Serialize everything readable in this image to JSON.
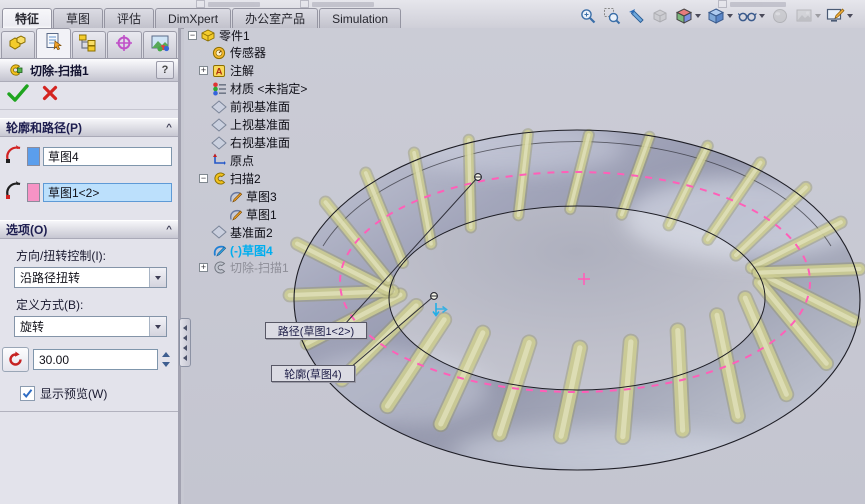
{
  "ribbon": {
    "tabs": [
      {
        "label": "特征",
        "active": true
      },
      {
        "label": "草图",
        "active": false
      },
      {
        "label": "评估",
        "active": false
      },
      {
        "label": "DimXpert",
        "active": false
      },
      {
        "label": "办公室产品",
        "active": false
      },
      {
        "label": "Simulation",
        "active": false
      }
    ]
  },
  "headsup": {
    "icons": [
      {
        "name": "zoom-fit",
        "disabled": false,
        "caret": false
      },
      {
        "name": "zoom-area",
        "disabled": false,
        "caret": false
      },
      {
        "name": "previous-view",
        "disabled": false,
        "caret": false
      },
      {
        "name": "section-view",
        "disabled": true,
        "caret": false
      },
      {
        "name": "view-orientation",
        "disabled": false,
        "caret": true
      },
      {
        "name": "display-style",
        "disabled": false,
        "caret": true
      },
      {
        "name": "hide-show-items",
        "disabled": false,
        "caret": true
      },
      {
        "name": "edit-appearance",
        "disabled": true,
        "caret": false
      },
      {
        "name": "apply-scene",
        "disabled": true,
        "caret": true
      },
      {
        "name": "view-settings",
        "disabled": false,
        "caret": true
      }
    ]
  },
  "property_manager": {
    "panel_tabs": [
      {
        "name": "feature-manager",
        "active": false
      },
      {
        "name": "property-manager",
        "active": true
      },
      {
        "name": "configuration-manager",
        "active": false
      },
      {
        "name": "dimxpert-manager",
        "active": false
      },
      {
        "name": "display-manager",
        "active": false
      }
    ],
    "title": "切除-扫描1",
    "help": "?",
    "profile_path": {
      "header": "轮廓和路径(P)",
      "profile_value": "草图4",
      "path_value": "草图1<2>"
    },
    "options": {
      "header": "选项(O)",
      "twist_label": "方向/扭转控制(I):",
      "twist_value": "沿路径扭转",
      "define_label": "定义方式(B):",
      "define_value": "旋转",
      "turns_value": "30.00",
      "preview_label": "显示预览(W)",
      "preview_checked": true
    }
  },
  "feature_tree": {
    "items": [
      {
        "label": "零件1",
        "icon": "part",
        "level": 0,
        "expander": "minus"
      },
      {
        "label": "传感器",
        "icon": "sensors",
        "level": 1,
        "expander": ""
      },
      {
        "label": "注解",
        "icon": "annotations",
        "level": 1,
        "expander": "plus"
      },
      {
        "label": "材质 <未指定>",
        "icon": "material",
        "level": 1,
        "expander": ""
      },
      {
        "label": "前视基准面",
        "icon": "plane",
        "level": 1,
        "expander": ""
      },
      {
        "label": "上视基准面",
        "icon": "plane",
        "level": 1,
        "expander": ""
      },
      {
        "label": "右视基准面",
        "icon": "plane",
        "level": 1,
        "expander": ""
      },
      {
        "label": "原点",
        "icon": "origin",
        "level": 1,
        "expander": ""
      },
      {
        "label": "扫描2",
        "icon": "sweep",
        "level": 1,
        "expander": "minus"
      },
      {
        "label": "草图3",
        "icon": "sketch",
        "level": 2,
        "expander": ""
      },
      {
        "label": "草图1",
        "icon": "sketch",
        "level": 2,
        "expander": ""
      },
      {
        "label": "基准面2",
        "icon": "plane",
        "level": 1,
        "expander": ""
      },
      {
        "label": "(-)草图4",
        "icon": "sketch-selected",
        "level": 1,
        "expander": "",
        "state": "selected"
      },
      {
        "label": "切除-扫描1",
        "icon": "sweep-cut",
        "level": 1,
        "expander": "plus",
        "state": "dimmed"
      }
    ]
  },
  "viewport": {
    "callouts": [
      {
        "label": "路径(草图1<2>)"
      },
      {
        "label": "轮廓(草图4)"
      }
    ]
  },
  "colors": {
    "selection_highlight": "#BCE0FC",
    "path_pink": "#FF5FB8",
    "coil_khaki": "#CFCF94",
    "viewport_bg": "#C7C8D2",
    "selected_tree_text": "#00AEEF"
  }
}
